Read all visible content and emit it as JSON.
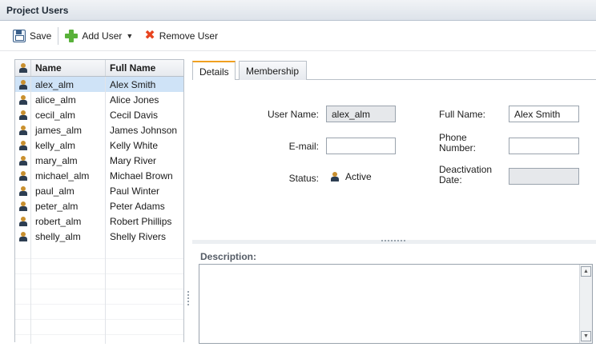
{
  "window": {
    "title": "Project Users"
  },
  "toolbar": {
    "save_label": "Save",
    "add_user_label": "Add User",
    "remove_user_label": "Remove User"
  },
  "users_grid": {
    "columns": [
      "Name",
      "Full Name"
    ],
    "rows": [
      {
        "name": "alex_alm",
        "full_name": "Alex Smith",
        "selected": true
      },
      {
        "name": "alice_alm",
        "full_name": "Alice Jones"
      },
      {
        "name": "cecil_alm",
        "full_name": "Cecil Davis"
      },
      {
        "name": "james_alm",
        "full_name": "James Johnson"
      },
      {
        "name": "kelly_alm",
        "full_name": "Kelly White"
      },
      {
        "name": "mary_alm",
        "full_name": "Mary River"
      },
      {
        "name": "michael_alm",
        "full_name": "Michael Brown"
      },
      {
        "name": "paul_alm",
        "full_name": "Paul Winter"
      },
      {
        "name": "peter_alm",
        "full_name": "Peter Adams"
      },
      {
        "name": "robert_alm",
        "full_name": "Robert Phillips"
      },
      {
        "name": "shelly_alm",
        "full_name": "Shelly Rivers"
      }
    ]
  },
  "tabs": [
    {
      "label": "Details",
      "active": true
    },
    {
      "label": "Membership",
      "active": false
    }
  ],
  "details": {
    "user_name_label": "User Name:",
    "user_name_value": "alex_alm",
    "full_name_label": "Full Name:",
    "full_name_value": "Alex Smith",
    "email_label": "E-mail:",
    "email_value": "",
    "phone_label_line1": "Phone",
    "phone_label_line2": "Number:",
    "phone_value": "",
    "status_label": "Status:",
    "status_value": "Active",
    "deactivation_label_line1": "Deactivation",
    "deactivation_label_line2": "Date:",
    "deactivation_value": ""
  },
  "description": {
    "label": "Description:",
    "value": ""
  },
  "colors": {
    "selected_row": "#cfe3f7",
    "active_tab_accent": "#f0a020",
    "add_icon": "#59b13a",
    "remove_icon": "#e8441f"
  },
  "icons": {
    "save": "save-icon",
    "add": "add-icon",
    "remove": "remove-icon",
    "user": "user-icon"
  }
}
